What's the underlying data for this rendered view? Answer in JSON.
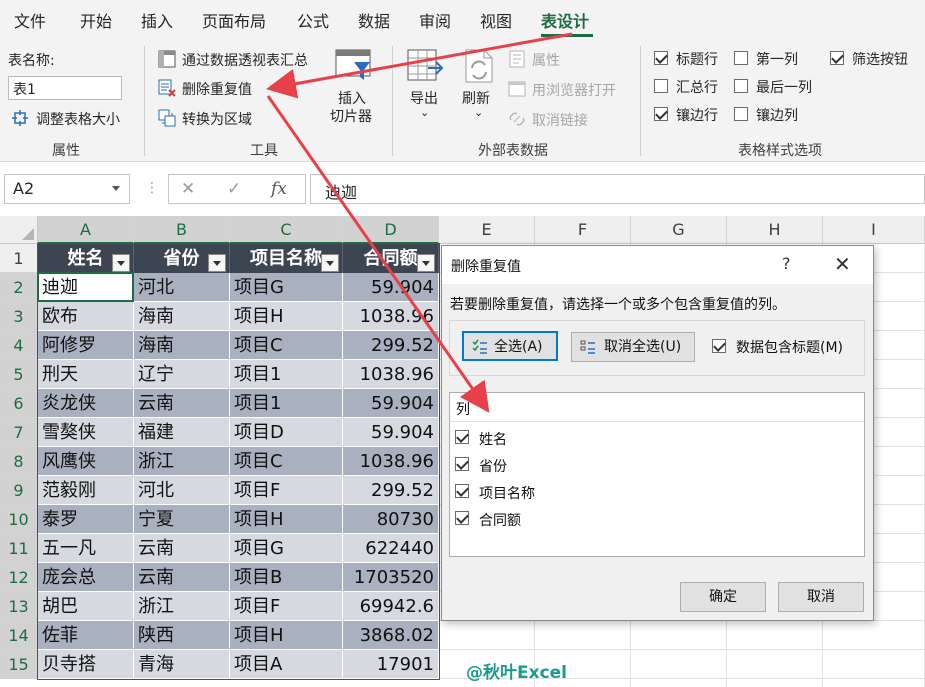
{
  "menu": {
    "tabs": [
      "文件",
      "开始",
      "插入",
      "页面布局",
      "公式",
      "数据",
      "审阅",
      "视图",
      "表设计"
    ],
    "active_index": 8
  },
  "ribbon": {
    "properties": {
      "table_name_label": "表名称:",
      "table_name_value": "表1",
      "resize_label": "调整表格大小",
      "group_label": "属性"
    },
    "tools": {
      "pivot_label": "通过数据透视表汇总",
      "remove_dup_label": "删除重复值",
      "convert_label": "转换为区域",
      "slicer_label_1": "插入",
      "slicer_label_2": "切片器",
      "group_label": "工具"
    },
    "external": {
      "export_label": "导出",
      "refresh_label": "刷新",
      "properties_label": "属性",
      "browser_label": "用浏览器打开",
      "unlink_label": "取消链接",
      "group_label": "外部表数据"
    },
    "style_options": {
      "items": [
        {
          "label": "标题行",
          "checked": true
        },
        {
          "label": "第一列",
          "checked": false
        },
        {
          "label": "筛选按钮",
          "checked": true
        },
        {
          "label": "汇总行",
          "checked": false
        },
        {
          "label": "最后一列",
          "checked": false
        },
        {
          "label": "镶边行",
          "checked": true
        },
        {
          "label": "镶边列",
          "checked": false
        }
      ],
      "group_label": "表格样式选项"
    }
  },
  "formula_bar": {
    "name_box": "A2",
    "fx": "fx",
    "content": "迪迦"
  },
  "grid": {
    "col_headers": [
      "A",
      "B",
      "C",
      "D",
      "E",
      "F",
      "G",
      "H",
      "I"
    ],
    "row_headers": [
      "1",
      "2",
      "3",
      "4",
      "5",
      "6",
      "7",
      "8",
      "9",
      "10",
      "11",
      "12",
      "13",
      "14",
      "15"
    ],
    "table_headers": [
      "姓名",
      "省份",
      "项目名称",
      "合同额"
    ],
    "rows": [
      [
        "迪迦",
        "河北",
        "项目G",
        "59.904"
      ],
      [
        "欧布",
        "海南",
        "项目H",
        "1038.96"
      ],
      [
        "阿修罗",
        "海南",
        "项目C",
        "299.52"
      ],
      [
        "刑天",
        "辽宁",
        "项目1",
        "1038.96"
      ],
      [
        "炎龙侠",
        "云南",
        "项目1",
        "59.904"
      ],
      [
        "雪獒侠",
        "福建",
        "项目D",
        "59.904"
      ],
      [
        "风鹰侠",
        "浙江",
        "项目C",
        "1038.96"
      ],
      [
        "范毅刚",
        "河北",
        "项目F",
        "299.52"
      ],
      [
        "泰罗",
        "宁夏",
        "项目H",
        "80730"
      ],
      [
        "五一凡",
        "云南",
        "项目G",
        "622440"
      ],
      [
        "庞会总",
        "云南",
        "项目B",
        "1703520"
      ],
      [
        "胡巴",
        "浙江",
        "项目F",
        "69942.6"
      ],
      [
        "佐菲",
        "陕西",
        "项目H",
        "3868.02"
      ],
      [
        "贝寺搭",
        "青海",
        "项目A",
        "17901"
      ]
    ],
    "colors": {
      "header_bg": "#3e4552",
      "band_dark": "#a9b0bf",
      "band_light": "#d6d9e0",
      "accent": "#1e6c41"
    }
  },
  "dialog": {
    "title": "删除重复值",
    "help": "?",
    "close": "✕",
    "prompt": "若要删除重复值，请选择一个或多个包含重复值的列。",
    "select_all": "全选(A)",
    "unselect_all": "取消全选(U)",
    "has_header_label": "数据包含标题(M)",
    "has_header_checked": true,
    "list_header": "列",
    "columns": [
      {
        "label": "姓名",
        "checked": true
      },
      {
        "label": "省份",
        "checked": true
      },
      {
        "label": "项目名称",
        "checked": true
      },
      {
        "label": "合同额",
        "checked": true
      }
    ],
    "ok": "确定",
    "cancel": "取消"
  },
  "watermark": "@秋叶Excel",
  "annotation_color": "#e8404a"
}
